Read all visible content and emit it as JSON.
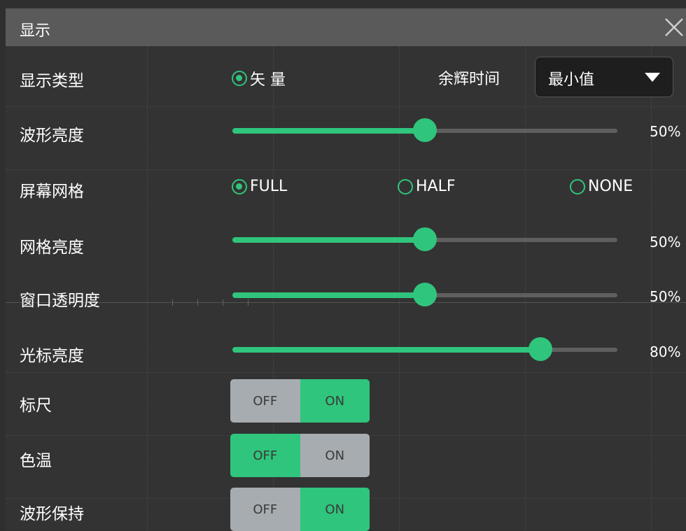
{
  "title": "显示",
  "colors": {
    "accent": "#2fc57c",
    "titlebar": "#5a5a5a",
    "panel": "#333333"
  },
  "rows": {
    "display_type": {
      "label": "显示类型",
      "option": "矢 量",
      "option_selected": true
    },
    "persistence": {
      "label": "余辉时间",
      "value": "最小值"
    },
    "wave_brightness": {
      "label": "波形亮度",
      "value_text": "50%",
      "value": 0.5
    },
    "screen_grid": {
      "label": "屏幕网格",
      "options": [
        {
          "label": "FULL",
          "selected": true
        },
        {
          "label": "HALF",
          "selected": false
        },
        {
          "label": "NONE",
          "selected": false
        }
      ]
    },
    "grid_brightness": {
      "label": "网格亮度",
      "value_text": "50%",
      "value": 0.5
    },
    "window_transparency": {
      "label": "窗口透明度",
      "value_text": "50%",
      "value": 0.5
    },
    "cursor_brightness": {
      "label": "光标亮度",
      "value_text": "80%",
      "value": 0.8
    },
    "ruler": {
      "label": "标尺",
      "off": "OFF",
      "on": "ON",
      "state": "ON"
    },
    "color_temp": {
      "label": "色温",
      "off": "OFF",
      "on": "ON",
      "state": "OFF"
    },
    "wave_hold": {
      "label": "波形保持",
      "off": "OFF",
      "on": "ON",
      "state": "ON"
    }
  },
  "icons": {
    "close": "close-icon",
    "dropdown": "caret-down-icon"
  }
}
